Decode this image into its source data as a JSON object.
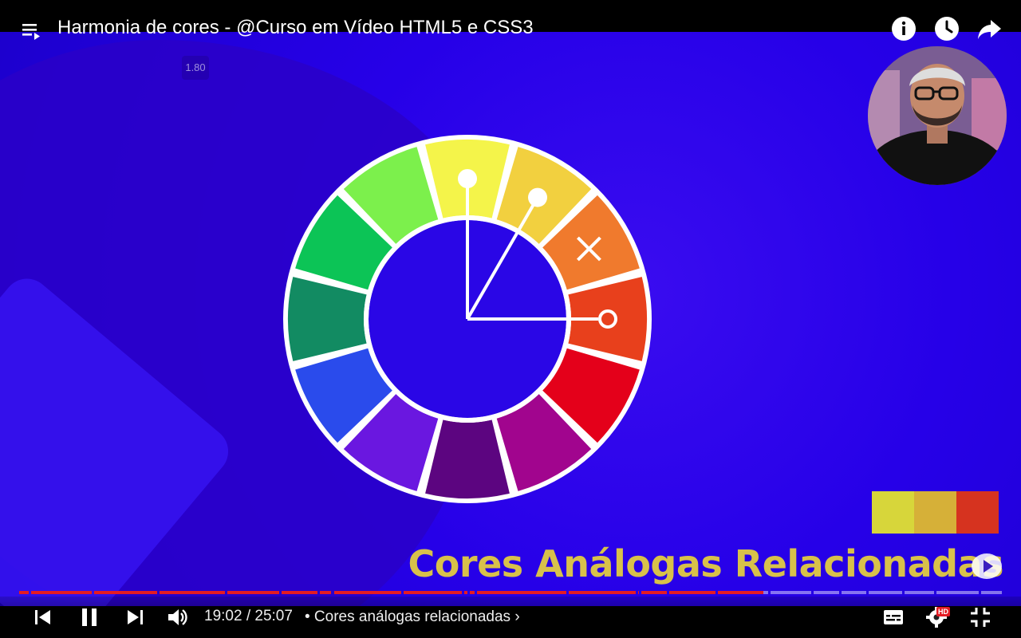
{
  "video": {
    "title": "Harmonia de cores - @Curso em Vídeo HTML5 e CSS3",
    "speed_label": "1.80",
    "overlay_title": "Cores Análogas Relacionadas",
    "swatch_colors": [
      "#d7d63a",
      "#d6b038",
      "#d6331f"
    ],
    "wheel_colors": [
      "#f4f44a",
      "#f2d03f",
      "#f07a2d",
      "#e8401c",
      "#e4001a",
      "#a1058e",
      "#5c0580",
      "#6a17e0",
      "#2a4bec",
      "#128b62",
      "#0cc456",
      "#7cf04c"
    ]
  },
  "player": {
    "time": "19:02 / 25:07",
    "chapter": "• Cores análogas relacionadas",
    "chapter_chevron": "›",
    "hd_label": "HD",
    "progress_fraction": 0.757
  },
  "icons": {
    "playlist": "playlist-icon",
    "info": "info-icon",
    "watch_later": "clock-icon",
    "share": "share-icon",
    "prev": "skip-previous-icon",
    "pause": "pause-icon",
    "next": "skip-next-icon",
    "volume": "volume-icon",
    "captions": "captions-icon",
    "settings": "gear-icon",
    "exit_fullscreen": "exit-fullscreen-icon"
  }
}
